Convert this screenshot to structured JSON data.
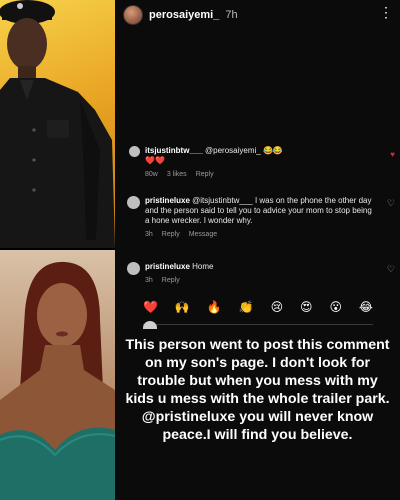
{
  "story": {
    "username": "perosaiyemi_",
    "time": "7h",
    "menu_icon": "⋮"
  },
  "comments": [
    {
      "user": "itsjustinbtw___",
      "text": "@perosaiyemi_ 😂😂",
      "emojis": "❤️❤️",
      "meta": [
        "80w",
        "3 likes",
        "Reply"
      ]
    },
    {
      "user": "pristineluxe",
      "text": "@itsjustinbtw___ I was on the phone the other day and the person said to tell you to advice your mom to stop being a hone wrecker. I wonder why.",
      "meta": [
        "3h",
        "Reply",
        "Message"
      ]
    },
    {
      "user": "pristineluxe",
      "text": "Home",
      "meta": [
        "3h",
        "Reply"
      ]
    }
  ],
  "emoji_bar": [
    "❤️",
    "🙌",
    "🔥",
    "👏",
    "😢",
    "😍",
    "😮",
    "😂"
  ],
  "caption": "This person went to post this comment on my son's page. I don't look for trouble but when you mess with my kids u mess with the whole trailer park. @pristineluxe you will never know peace.I will find you believe."
}
